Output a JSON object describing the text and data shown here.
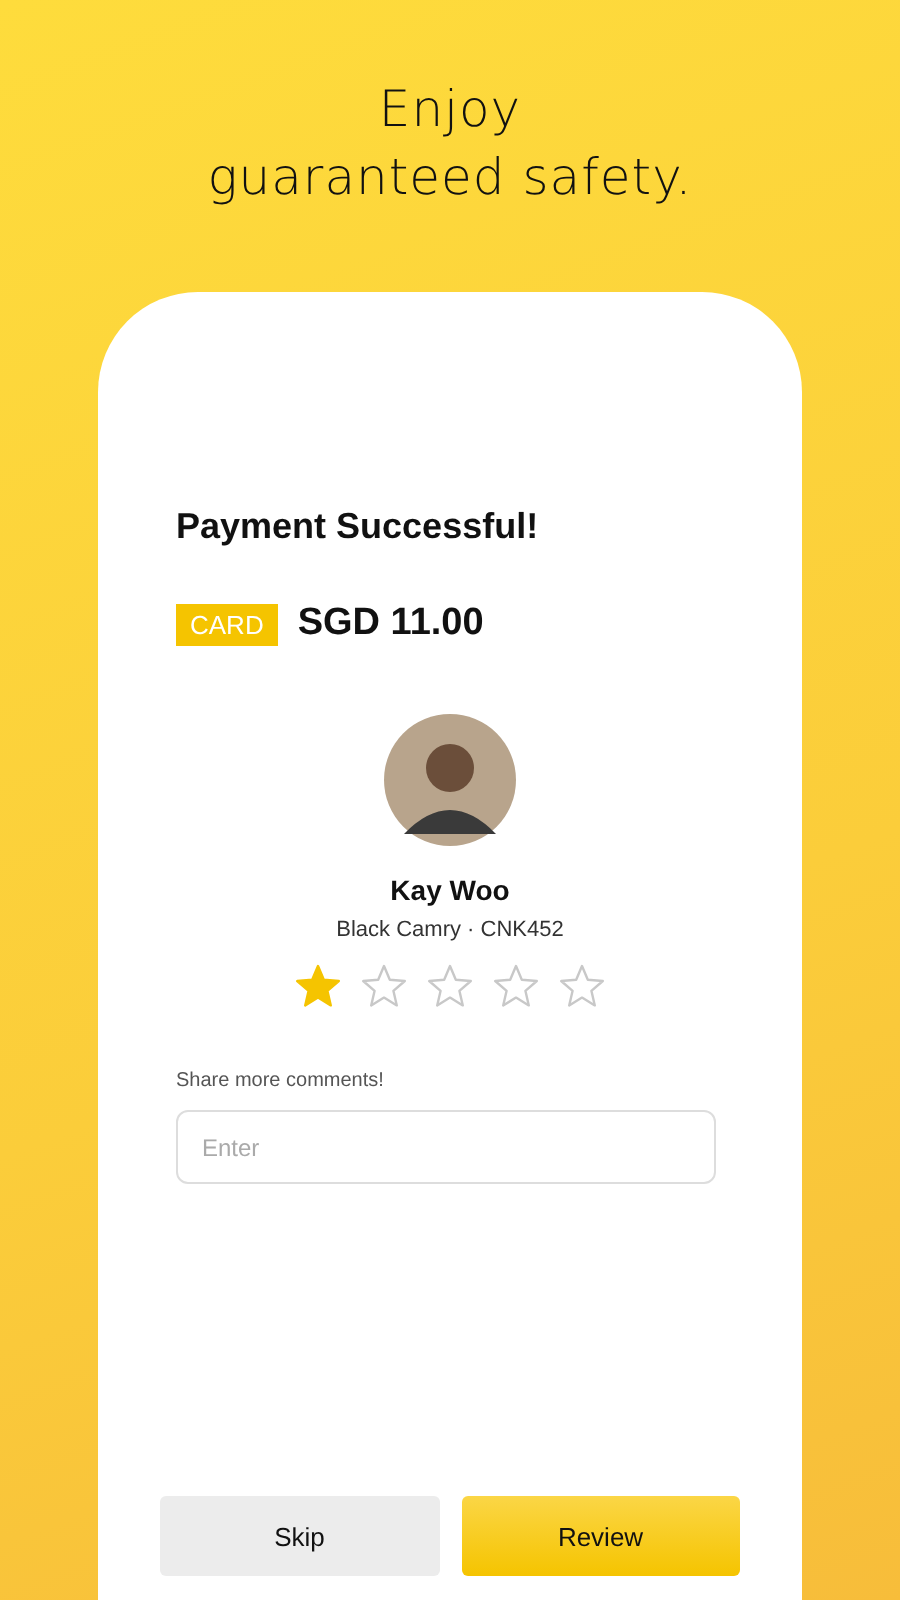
{
  "headline": "Enjoy\nguaranteed safety.",
  "payment": {
    "title": "Payment Successful!",
    "method": "CARD",
    "amount": "SGD 11.00"
  },
  "driver": {
    "name": "Kay Woo",
    "vehicle": "Black Camry · CNK452",
    "stars": 1
  },
  "comments": {
    "label": "Share more comments!",
    "placeholder": "Enter"
  },
  "buttons": [
    {
      "label": "Skip",
      "kind": "secondary"
    },
    {
      "label": "Review",
      "kind": "primary"
    }
  ]
}
